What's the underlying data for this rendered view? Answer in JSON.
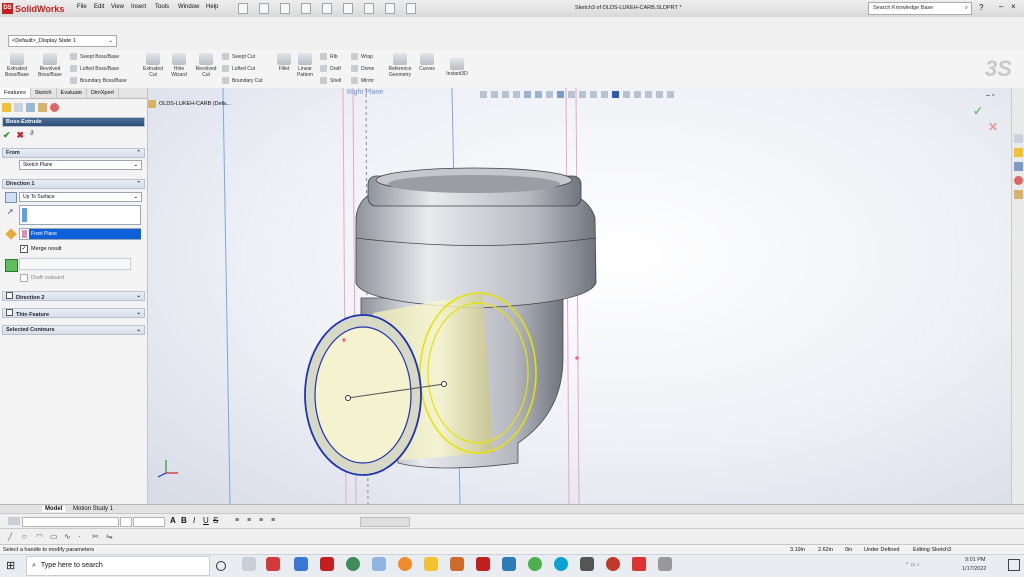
{
  "app": {
    "name": "SolidWorks",
    "doc_title": "Sketch3 of OLDS-LUKEH-CARB.SLDPRT *",
    "search_placeholder": "Search Knowledge Base"
  },
  "menu": [
    "File",
    "Edit",
    "View",
    "Insert",
    "Tools",
    "Window",
    "Help"
  ],
  "config": {
    "selected": "<Default>_Display State 1"
  },
  "ribbon": {
    "large": [
      "Extruded Boss/Base",
      "Revolved Boss/Base"
    ],
    "stack1": [
      "Swept Boss/Base",
      "Lofted Boss/Base",
      "Boundary Boss/Base"
    ],
    "cut_large": [
      "Extruded Cut",
      "Hole Wizard",
      "Revolved Cut"
    ],
    "stack2": [
      "Swept Cut",
      "Lofted Cut",
      "Boundary Cut"
    ],
    "fillet": "Fillet",
    "linear_pattern": "Linear Pattern",
    "stack3": [
      "Rib",
      "Draft",
      "Shell"
    ],
    "stack4": [
      "Wrap",
      "Dome",
      "Mirror"
    ],
    "ref_geom": "Reference Geometry",
    "curves": "Curves",
    "instant3d": "Instant3D"
  },
  "tabs": [
    "Features",
    "Sketch",
    "Evaluate",
    "DimXpert"
  ],
  "property_manager": {
    "title": "Boss-Extrude",
    "from": {
      "header": "From",
      "value": "Sketch Plane"
    },
    "direction1": {
      "header": "Direction 1",
      "end_condition": "Up To Surface",
      "face": "Front Plane",
      "merge_result": "Merge result",
      "draft_outward": "Draft outward"
    },
    "direction2": "Direction 2",
    "thin_feature": "Thin Feature",
    "selected_contours": "Selected Contours"
  },
  "tree": {
    "root": "OLDS-LUKEH-CARB (Defa..."
  },
  "viewport": {
    "plane_label": "Right Plane"
  },
  "bottom_tabs": [
    "Model",
    "Motion Study 1"
  ],
  "status": {
    "message": "Select a handle to modify parameters",
    "x": "3.19in",
    "y": "2.62in",
    "z": "0in",
    "definition": "Under Defined",
    "editing": "Editing Sketch3"
  },
  "taskbar": {
    "search": "Type here to search",
    "time": "9:01 PM",
    "date": "1/17/2022"
  },
  "colors": {
    "accent": "#c41f1f",
    "selection_blue": "#1d33b5",
    "preview_yellow": "#e6e300",
    "plane_pink": "#e8a7c4"
  }
}
